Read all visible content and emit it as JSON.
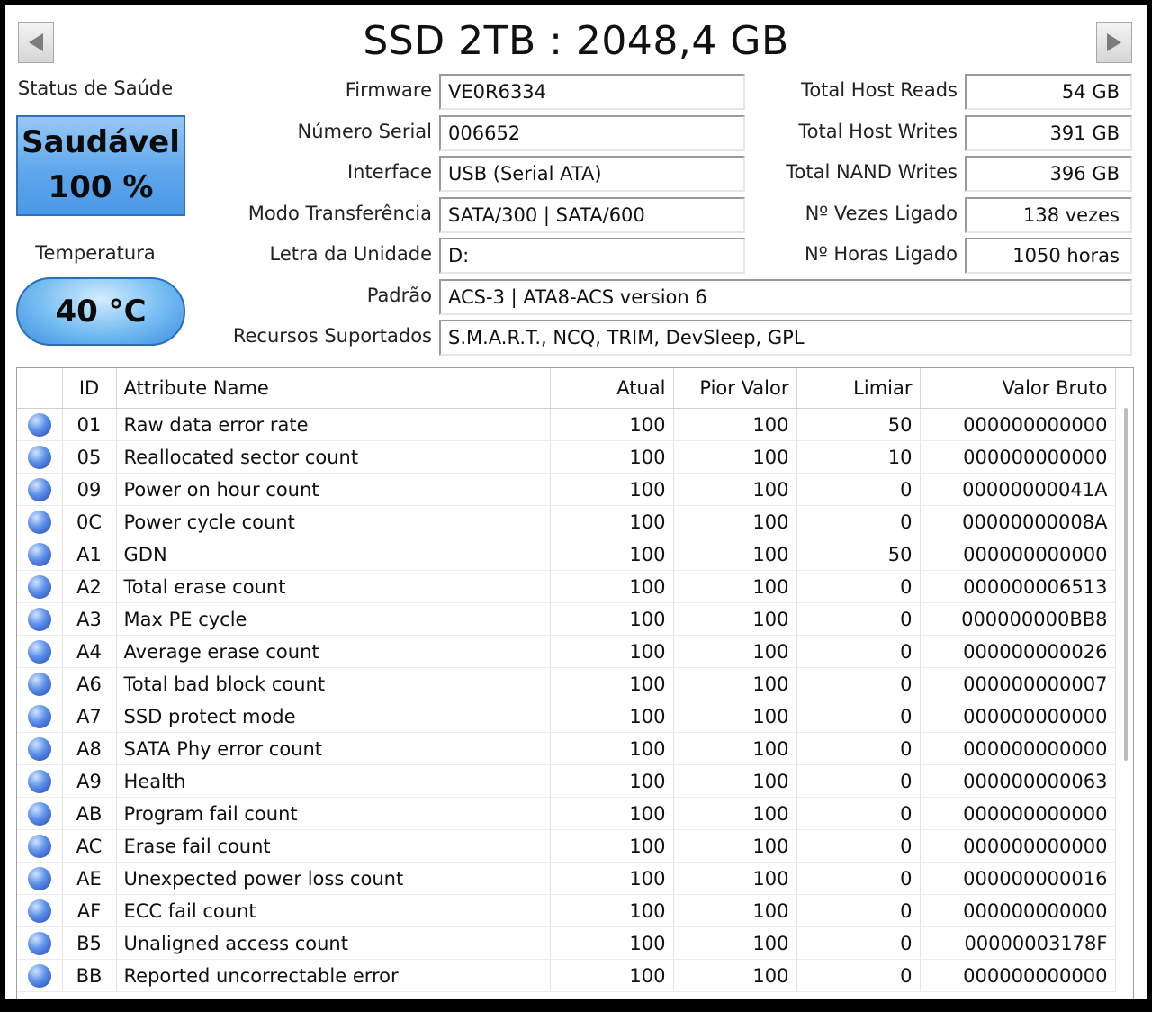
{
  "window": {
    "title": "SSD 2TB : 2048,4 GB"
  },
  "health": {
    "label": "Status de Saúde",
    "status": "Saudável",
    "percent": "100 %"
  },
  "temperature": {
    "label": "Temperatura",
    "value": "40 °C"
  },
  "fields": {
    "firmware": {
      "label": "Firmware",
      "value": "VE0R6334"
    },
    "serial": {
      "label": "Número Serial",
      "value": "006652"
    },
    "interface": {
      "label": "Interface",
      "value": "USB (Serial ATA)"
    },
    "transfer_mode": {
      "label": "Modo Transferência",
      "value": "SATA/300 | SATA/600"
    },
    "drive_letter": {
      "label": "Letra da Unidade",
      "value": "D:"
    },
    "standard": {
      "label": "Padrão",
      "value": "ACS-3 | ATA8-ACS version 6"
    },
    "features": {
      "label": "Recursos Suportados",
      "value": "S.M.A.R.T., NCQ, TRIM, DevSleep, GPL"
    }
  },
  "stats": {
    "host_reads": {
      "label": "Total Host Reads",
      "value": "54 GB"
    },
    "host_writes": {
      "label": "Total Host Writes",
      "value": "391 GB"
    },
    "nand_writes": {
      "label": "Total NAND Writes",
      "value": "396 GB"
    },
    "power_on_count": {
      "label": "Nº Vezes Ligado",
      "value": "138 vezes"
    },
    "power_on_hours": {
      "label": "Nº Horas Ligado",
      "value": "1050 horas"
    }
  },
  "table": {
    "headers": {
      "id": "ID",
      "name": "Attribute Name",
      "current": "Atual",
      "worst": "Pior Valor",
      "threshold": "Limiar",
      "raw": "Valor Bruto"
    },
    "status_icon": "blue-circle-icon",
    "rows": [
      {
        "id": "01",
        "name": "Raw data error rate",
        "current": "100",
        "worst": "100",
        "threshold": "50",
        "raw": "000000000000"
      },
      {
        "id": "05",
        "name": "Reallocated sector count",
        "current": "100",
        "worst": "100",
        "threshold": "10",
        "raw": "000000000000"
      },
      {
        "id": "09",
        "name": "Power on hour count",
        "current": "100",
        "worst": "100",
        "threshold": "0",
        "raw": "00000000041A"
      },
      {
        "id": "0C",
        "name": "Power cycle count",
        "current": "100",
        "worst": "100",
        "threshold": "0",
        "raw": "00000000008A"
      },
      {
        "id": "A1",
        "name": "GDN",
        "current": "100",
        "worst": "100",
        "threshold": "50",
        "raw": "000000000000"
      },
      {
        "id": "A2",
        "name": "Total erase count",
        "current": "100",
        "worst": "100",
        "threshold": "0",
        "raw": "000000006513"
      },
      {
        "id": "A3",
        "name": "Max PE cycle",
        "current": "100",
        "worst": "100",
        "threshold": "0",
        "raw": "000000000BB8"
      },
      {
        "id": "A4",
        "name": "Average erase count",
        "current": "100",
        "worst": "100",
        "threshold": "0",
        "raw": "000000000026"
      },
      {
        "id": "A6",
        "name": "Total bad block count",
        "current": "100",
        "worst": "100",
        "threshold": "0",
        "raw": "000000000007"
      },
      {
        "id": "A7",
        "name": "SSD protect mode",
        "current": "100",
        "worst": "100",
        "threshold": "0",
        "raw": "000000000000"
      },
      {
        "id": "A8",
        "name": "SATA Phy error count",
        "current": "100",
        "worst": "100",
        "threshold": "0",
        "raw": "000000000000"
      },
      {
        "id": "A9",
        "name": "Health",
        "current": "100",
        "worst": "100",
        "threshold": "0",
        "raw": "000000000063"
      },
      {
        "id": "AB",
        "name": "Program fail count",
        "current": "100",
        "worst": "100",
        "threshold": "0",
        "raw": "000000000000"
      },
      {
        "id": "AC",
        "name": "Erase fail count",
        "current": "100",
        "worst": "100",
        "threshold": "0",
        "raw": "000000000000"
      },
      {
        "id": "AE",
        "name": "Unexpected power loss count",
        "current": "100",
        "worst": "100",
        "threshold": "0",
        "raw": "000000000016"
      },
      {
        "id": "AF",
        "name": "ECC fail count",
        "current": "100",
        "worst": "100",
        "threshold": "0",
        "raw": "000000000000"
      },
      {
        "id": "B5",
        "name": "Unaligned access count",
        "current": "100",
        "worst": "100",
        "threshold": "0",
        "raw": "00000003178F"
      },
      {
        "id": "BB",
        "name": "Reported uncorrectable error",
        "current": "100",
        "worst": "100",
        "threshold": "0",
        "raw": "000000000000"
      }
    ]
  }
}
